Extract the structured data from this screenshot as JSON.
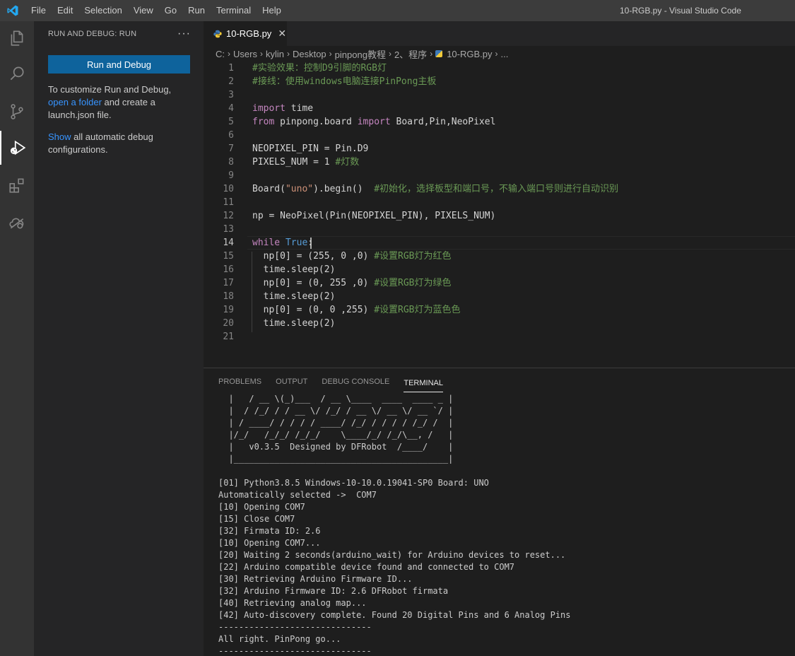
{
  "window": {
    "title": "10-RGB.py - Visual Studio Code",
    "menu": [
      "File",
      "Edit",
      "Selection",
      "View",
      "Go",
      "Run",
      "Terminal",
      "Help"
    ]
  },
  "activity_bar": {
    "items": [
      "explorer-icon",
      "search-icon",
      "source-control-icon",
      "run-debug-icon",
      "extensions-icon",
      "remote-explorer-icon"
    ],
    "active": "run-debug-icon"
  },
  "sidebar": {
    "title": "RUN AND DEBUG: RUN",
    "more": "···",
    "run_button": "Run and Debug",
    "text1_a": "To customize Run and Debug,",
    "text1_link": "open a folder",
    "text1_b": " and create a",
    "text1_c": "launch.json file.",
    "text2_link": "Show",
    "text2_b": " all automatic debug",
    "text2_c": "configurations."
  },
  "editor": {
    "tab": {
      "label": "10-RGB.py",
      "close": "✕"
    },
    "breadcrumb": [
      "C:",
      "Users",
      "kylin",
      "Desktop",
      "pinpong教程",
      "2、程序",
      "10-RGB.py",
      "..."
    ],
    "active_line": 14,
    "lines": [
      [
        {
          "t": "#实验效果：控制D9引脚的RGB灯",
          "c": "cm"
        }
      ],
      [
        {
          "t": "#接线：使用windows电脑连接PinPong主板",
          "c": "cm"
        }
      ],
      [],
      [
        {
          "t": "import",
          "c": "kw"
        },
        {
          "t": " time",
          "c": "nm"
        }
      ],
      [
        {
          "t": "from",
          "c": "kw"
        },
        {
          "t": " pinpong.board ",
          "c": "nm"
        },
        {
          "t": "import",
          "c": "kw"
        },
        {
          "t": " Board,Pin,NeoPixel",
          "c": "nm"
        }
      ],
      [],
      [
        {
          "t": "NEOPIXEL_PIN = Pin.D9",
          "c": "nm"
        }
      ],
      [
        {
          "t": "PIXELS_NUM = 1 ",
          "c": "nm"
        },
        {
          "t": "#灯数",
          "c": "cm"
        }
      ],
      [],
      [
        {
          "t": "Board(",
          "c": "nm"
        },
        {
          "t": "\"uno\"",
          "c": "st"
        },
        {
          "t": ").begin()  ",
          "c": "nm"
        },
        {
          "t": "#初始化，选择板型和端口号，不输入端口号则进行自动识别",
          "c": "cm"
        }
      ],
      [],
      [
        {
          "t": "np = NeoPixel(Pin(NEOPIXEL_PIN), PIXELS_NUM)",
          "c": "nm"
        }
      ],
      [],
      [
        {
          "t": "while",
          "c": "kw"
        },
        {
          "t": " ",
          "c": "nm"
        },
        {
          "t": "True",
          "c": "kb"
        },
        {
          "t": ":",
          "c": "nm"
        }
      ],
      [
        {
          "t": "  np[0] = (255, 0 ,0) ",
          "c": "nm"
        },
        {
          "t": "#设置RGB灯为红色",
          "c": "cm"
        }
      ],
      [
        {
          "t": "  time.sleep(2)",
          "c": "nm"
        }
      ],
      [
        {
          "t": "  np[0] = (0, 255 ,0) ",
          "c": "nm"
        },
        {
          "t": "#设置RGB灯为绿色",
          "c": "cm"
        }
      ],
      [
        {
          "t": "  time.sleep(2)",
          "c": "nm"
        }
      ],
      [
        {
          "t": "  np[0] = (0, 0 ,255) ",
          "c": "nm"
        },
        {
          "t": "#设置RGB灯为蓝色色",
          "c": "cm"
        }
      ],
      [
        {
          "t": "  time.sleep(2)",
          "c": "nm"
        }
      ],
      []
    ]
  },
  "panel": {
    "tabs": [
      "PROBLEMS",
      "OUTPUT",
      "DEBUG CONSOLE",
      "TERMINAL"
    ],
    "active_tab": "TERMINAL",
    "terminal_lines": [
      "  |   / __ \\(_)___  / __ \\____  ____  ____ _ |",
      "  |  / /_/ / / __ \\/ /_/ / __ \\/ __ \\/ __ `/ |",
      "  | / ____/ / / / / ____/ /_/ / / / / /_/ /  |",
      "  |/_/   /_/_/ /_/_/    \\____/_/ /_/\\__, /   |",
      "  |   v0.3.5  Designed by DFRobot  /____/    |",
      "  |__________________________________________|",
      "",
      "[01] Python3.8.5 Windows-10-10.0.19041-SP0 Board: UNO",
      "Automatically selected ->  COM7",
      "[10] Opening COM7",
      "[15] Close COM7",
      "[32] Firmata ID: 2.6",
      "[10] Opening COM7...",
      "[20] Waiting 2 seconds(arduino_wait) for Arduino devices to reset...",
      "[22] Arduino compatible device found and connected to COM7",
      "[30] Retrieving Arduino Firmware ID...",
      "[32] Arduino Firmware ID: 2.6 DFRobot firmata",
      "[40] Retrieving analog map...",
      "[42] Auto-discovery complete. Found 20 Digital Pins and 6 Analog Pins",
      "------------------------------",
      "All right. PinPong go...",
      "------------------------------"
    ]
  },
  "colors": {
    "accent": "#007acc",
    "button": "#0e639c",
    "link": "#3794ff",
    "comment": "#6a9955",
    "keyword": "#c586c0",
    "constant": "#569cd6",
    "string": "#ce9178"
  }
}
